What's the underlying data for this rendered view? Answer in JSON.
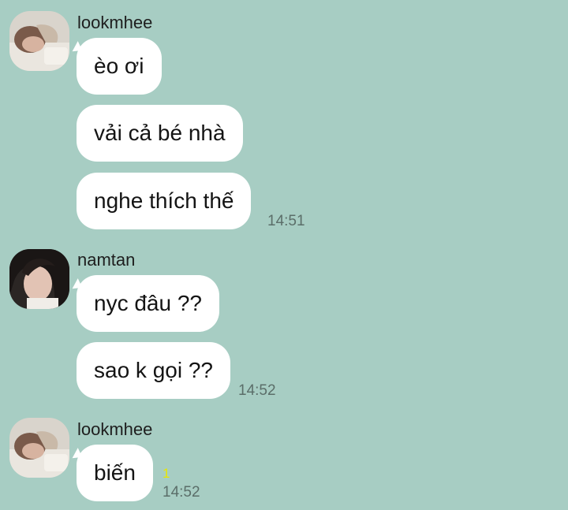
{
  "colors": {
    "background": "#a7cdc3",
    "bubble": "#ffffff",
    "timestamp": "#5b6e69",
    "read_count": "#e8e600"
  },
  "groups": [
    {
      "sender": "lookmhee",
      "avatar_icon": "user-avatar-photo",
      "messages": [
        "èo ơi",
        "vải cả bé nhà",
        "nghe thích thế"
      ],
      "time": "14:51"
    },
    {
      "sender": "namtan",
      "avatar_icon": "user-avatar-photo",
      "messages": [
        "nyc đâu ??",
        "sao k gọi ??"
      ],
      "time": "14:52"
    },
    {
      "sender": "lookmhee",
      "avatar_icon": "user-avatar-photo",
      "messages": [
        "biến"
      ],
      "read_count": "1",
      "time": "14:52"
    }
  ]
}
